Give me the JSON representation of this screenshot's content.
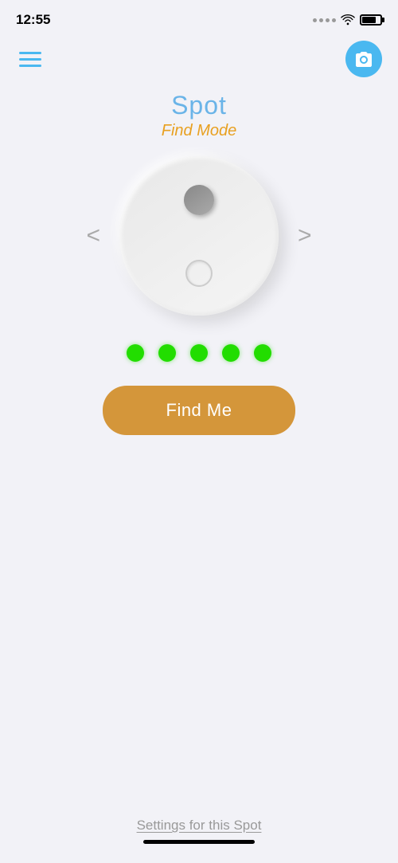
{
  "statusBar": {
    "time": "12:55"
  },
  "navBar": {
    "hamburger_label": "menu",
    "camera_label": "camera"
  },
  "device": {
    "title": "Spot",
    "mode": "Find Mode"
  },
  "navigation": {
    "left_arrow": "<",
    "right_arrow": ">"
  },
  "signals": {
    "dots": [
      1,
      2,
      3,
      4,
      5
    ]
  },
  "buttons": {
    "find_me": "Find Me"
  },
  "footer": {
    "settings_link": "Settings for this Spot"
  }
}
